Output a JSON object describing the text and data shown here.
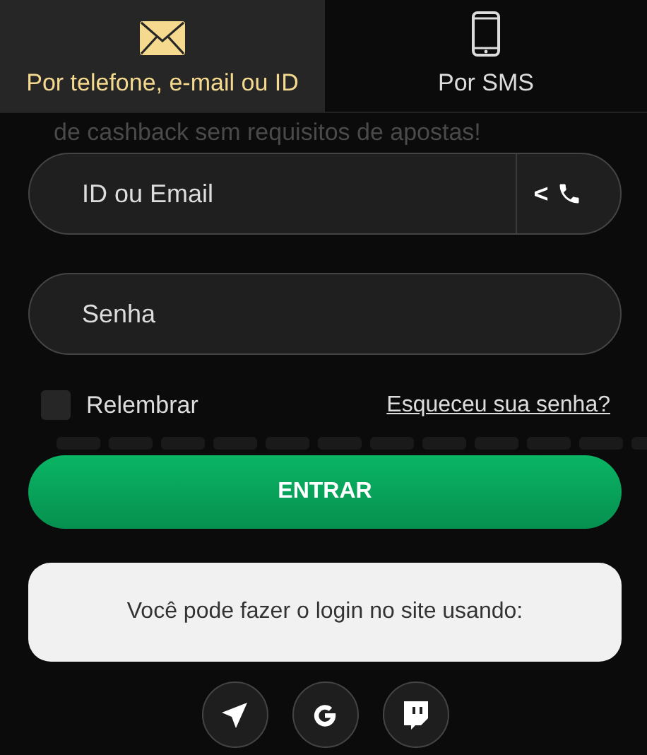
{
  "tabs": [
    {
      "label": "Por telefone, e-mail ou ID",
      "kind": "envelope",
      "selected": true
    },
    {
      "label": "Por SMS",
      "kind": "phone",
      "selected": false
    }
  ],
  "background_text": "de cashback sem requisitos de apostas!",
  "login_field": {
    "placeholder": "ID ou Email",
    "switch_arrow": "<"
  },
  "password_field": {
    "placeholder": "Senha"
  },
  "remember": {
    "label": "Relembrar",
    "checked": false
  },
  "forgot_link": "Esqueceu sua senha?",
  "submit_button": "ENTRAR",
  "social_prompt": "Você pode fazer o login no site usando:",
  "social_buttons": [
    {
      "kind": "telegram"
    },
    {
      "kind": "google"
    },
    {
      "kind": "twitch"
    }
  ]
}
